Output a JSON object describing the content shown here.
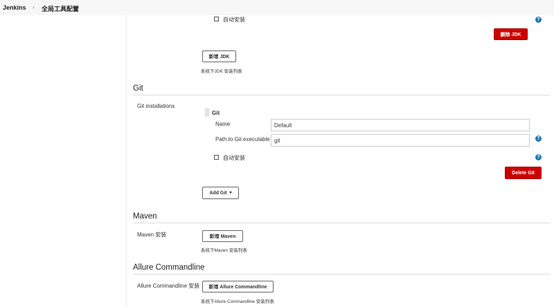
{
  "header": {
    "brand": "Jenkins",
    "separator": "›",
    "breadcrumb": "全局工具配置"
  },
  "jdk": {
    "auto_install_label": "自动安装",
    "delete_button": "删除 JDK",
    "add_button": "新增 JDK",
    "list_caption": "系统下JDK 安装列表"
  },
  "git": {
    "section_title": "Git",
    "installations_label": "Git installations",
    "block_title": "Git",
    "name_label": "Name",
    "name_value": "Default",
    "path_label": "Path to Git executable",
    "path_value": "git",
    "auto_install_label": "自动安装",
    "delete_button": "Delete Git",
    "add_button": "Add Git"
  },
  "maven": {
    "section_title": "Maven",
    "install_label": "Maven 安装",
    "add_button": "新增 Maven",
    "list_caption": "系统下Maven 安装列表"
  },
  "allure": {
    "section_title": "Allure Commandline",
    "install_label": "Allure Commandline 安装",
    "add_button": "新增 Allure Commandline",
    "list_caption": "系统下Allure Commandline 安装列表"
  },
  "icons": {
    "help": "?"
  },
  "colors": {
    "danger": "#cc0000",
    "help": "#1f78b4"
  }
}
